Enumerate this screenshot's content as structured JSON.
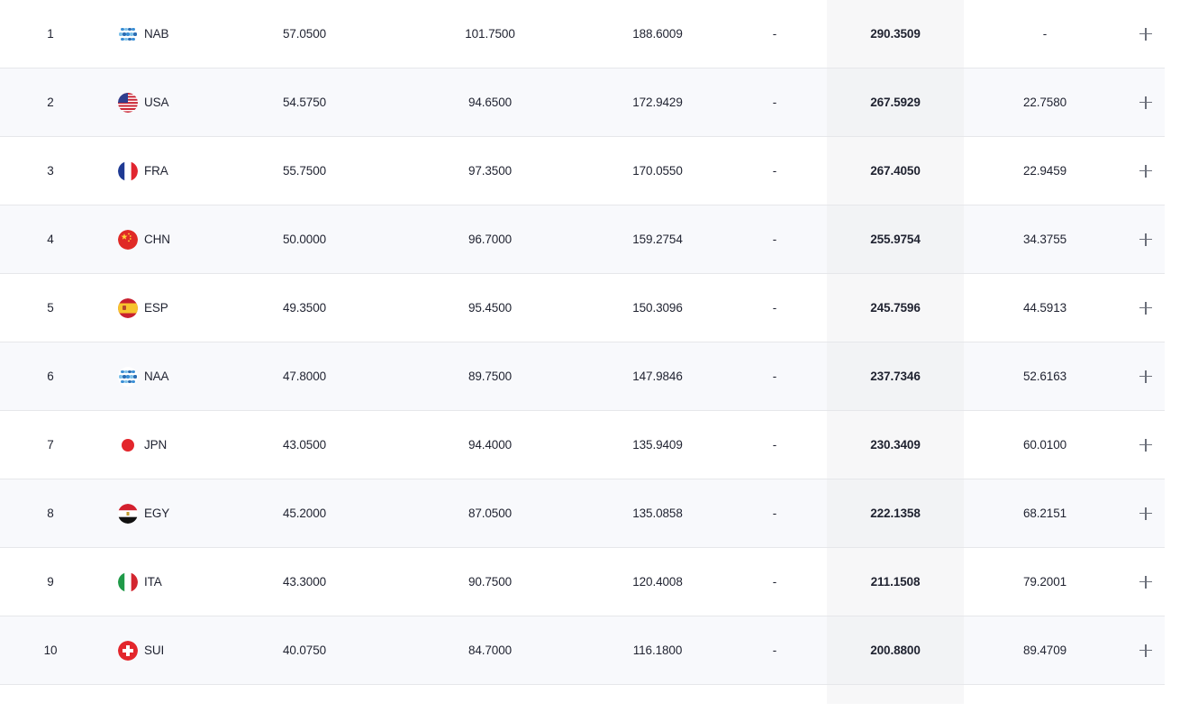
{
  "rows": [
    {
      "rank": "1",
      "nation": "NAB",
      "flag": "neutral-flag-icon",
      "r1": "57.0500",
      "r2": "101.7500",
      "r3": "188.6009",
      "r4": "-",
      "total": "290.3509",
      "behind": "-"
    },
    {
      "rank": "2",
      "nation": "USA",
      "flag": "usa-flag-icon",
      "r1": "54.5750",
      "r2": "94.6500",
      "r3": "172.9429",
      "r4": "-",
      "total": "267.5929",
      "behind": "22.7580"
    },
    {
      "rank": "3",
      "nation": "FRA",
      "flag": "france-flag-icon",
      "r1": "55.7500",
      "r2": "97.3500",
      "r3": "170.0550",
      "r4": "-",
      "total": "267.4050",
      "behind": "22.9459"
    },
    {
      "rank": "4",
      "nation": "CHN",
      "flag": "china-flag-icon",
      "r1": "50.0000",
      "r2": "96.7000",
      "r3": "159.2754",
      "r4": "-",
      "total": "255.9754",
      "behind": "34.3755"
    },
    {
      "rank": "5",
      "nation": "ESP",
      "flag": "spain-flag-icon",
      "r1": "49.3500",
      "r2": "95.4500",
      "r3": "150.3096",
      "r4": "-",
      "total": "245.7596",
      "behind": "44.5913"
    },
    {
      "rank": "6",
      "nation": "NAA",
      "flag": "neutral-flag-icon",
      "r1": "47.8000",
      "r2": "89.7500",
      "r3": "147.9846",
      "r4": "-",
      "total": "237.7346",
      "behind": "52.6163"
    },
    {
      "rank": "7",
      "nation": "JPN",
      "flag": "japan-flag-icon",
      "r1": "43.0500",
      "r2": "94.4000",
      "r3": "135.9409",
      "r4": "-",
      "total": "230.3409",
      "behind": "60.0100"
    },
    {
      "rank": "8",
      "nation": "EGY",
      "flag": "egypt-flag-icon",
      "r1": "45.2000",
      "r2": "87.0500",
      "r3": "135.0858",
      "r4": "-",
      "total": "222.1358",
      "behind": "68.2151"
    },
    {
      "rank": "9",
      "nation": "ITA",
      "flag": "italy-flag-icon",
      "r1": "43.3000",
      "r2": "90.7500",
      "r3": "120.4008",
      "r4": "-",
      "total": "211.1508",
      "behind": "79.2001"
    },
    {
      "rank": "10",
      "nation": "SUI",
      "flag": "switzerland-flag-icon",
      "r1": "40.0750",
      "r2": "84.7000",
      "r3": "116.1800",
      "r4": "-",
      "total": "200.8800",
      "behind": "89.4709"
    }
  ],
  "colors": {
    "text": "#1f2230",
    "row_alt_bg": "#f7f8fb",
    "total_column_bg": "#f7f7f8",
    "divider": "#e6e7ea",
    "plus_icon": "#6b6f7a"
  }
}
